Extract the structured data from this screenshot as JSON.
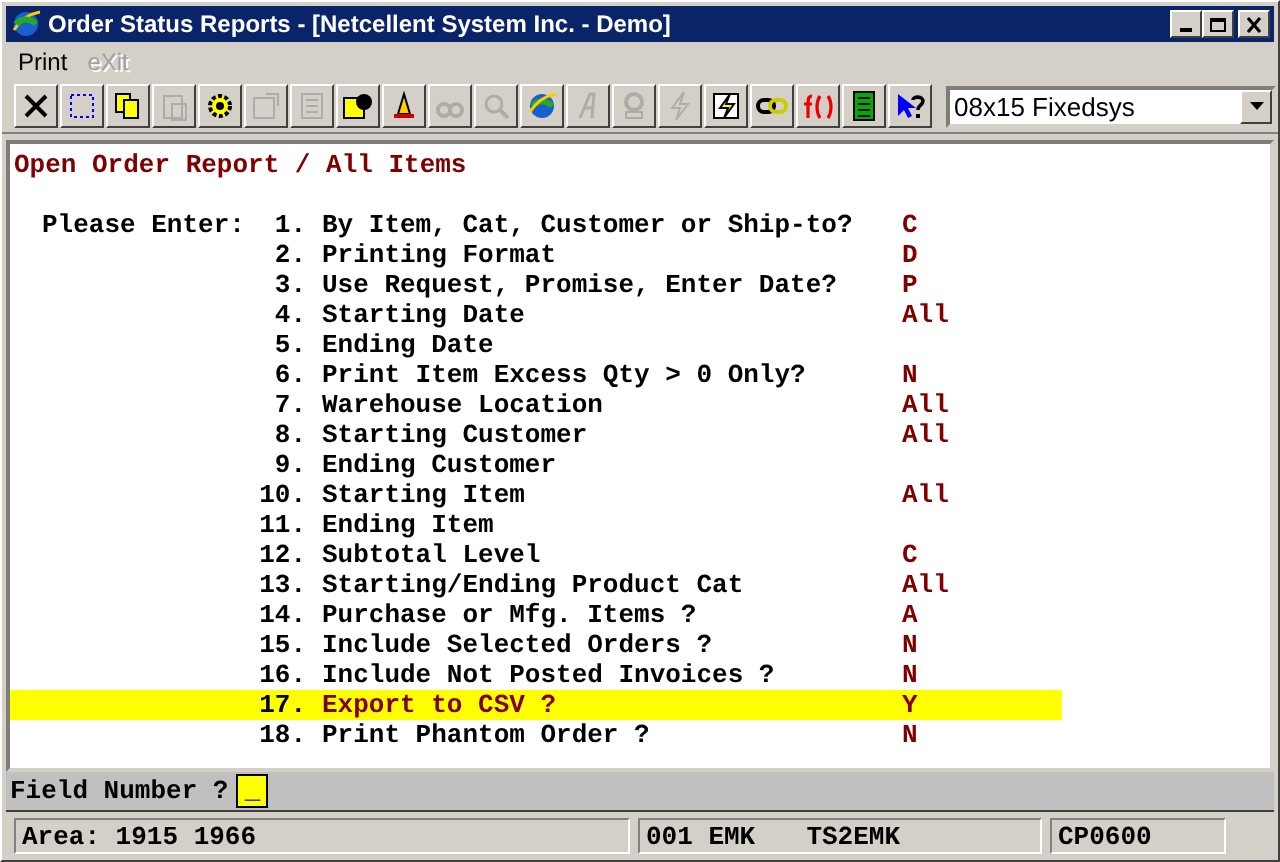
{
  "window": {
    "title": "Order Status Reports - [Netcellent System Inc. - Demo]"
  },
  "menu": [
    {
      "label": "Print",
      "disabled": false
    },
    {
      "label": "eXit",
      "disabled": true
    }
  ],
  "toolbar": [
    {
      "disabled": false
    },
    {
      "disabled": false
    },
    {
      "disabled": false
    },
    {
      "disabled": true
    },
    {
      "disabled": false
    },
    {
      "disabled": true
    },
    {
      "disabled": true
    },
    {
      "disabled": false
    },
    {
      "disabled": false
    },
    {
      "disabled": true
    },
    {
      "disabled": true
    },
    {
      "disabled": false
    },
    {
      "disabled": true
    },
    {
      "disabled": true
    },
    {
      "disabled": true
    },
    {
      "disabled": false
    },
    {
      "disabled": false
    },
    {
      "disabled": false
    },
    {
      "disabled": false
    },
    {
      "disabled": false
    }
  ],
  "font_select": {
    "value": "08x15 Fixedsys"
  },
  "report": {
    "title": "Open Order Report / All Items",
    "prompt": "Please Enter:",
    "fields": [
      {
        "number": "1.",
        "label": "By Item, Cat, Customer or Ship-to?",
        "value": "C",
        "selected": false
      },
      {
        "number": "2.",
        "label": "Printing Format",
        "value": "D",
        "selected": false
      },
      {
        "number": "3.",
        "label": "Use Request, Promise, Enter Date?",
        "value": "P",
        "selected": false
      },
      {
        "number": "4.",
        "label": "Starting Date",
        "value": "All",
        "selected": false
      },
      {
        "number": "5.",
        "label": "Ending Date",
        "selected": false
      },
      {
        "number": "6.",
        "label": "Print Item Excess Qty > 0 Only?",
        "value": "N",
        "selected": false
      },
      {
        "number": "7.",
        "label": "Warehouse Location",
        "value": "All",
        "selected": false
      },
      {
        "number": "8.",
        "label": "Starting Customer",
        "value": "All",
        "selected": false
      },
      {
        "number": "9.",
        "label": "Ending Customer",
        "selected": false
      },
      {
        "number": "10.",
        "label": "Starting Item",
        "value": "All",
        "selected": false
      },
      {
        "number": "11.",
        "label": "Ending Item",
        "selected": false
      },
      {
        "number": "12.",
        "label": "Subtotal Level",
        "value": "C",
        "selected": false
      },
      {
        "number": "13.",
        "label": "Starting/Ending Product Cat",
        "value": "All",
        "selected": false
      },
      {
        "number": "14.",
        "label": "Purchase or Mfg. Items ?",
        "value": "A",
        "selected": false
      },
      {
        "number": "15.",
        "label": "Include Selected Orders ?",
        "value": "N",
        "selected": false
      },
      {
        "number": "16.",
        "label": "Include Not Posted Invoices ?",
        "value": "N",
        "selected": false
      },
      {
        "number": "17.",
        "label": "Export to CSV ?",
        "value": "Y",
        "selected": true
      },
      {
        "number": "18.",
        "label": "Print Phantom Order ?",
        "value": "N",
        "selected": false
      }
    ]
  },
  "input_line": {
    "label": "Field Number ?",
    "value": "_"
  },
  "status_bar": [
    "Area: 1915 1966",
    "001 EMK",
    "TS2EMK",
    "CP0600"
  ]
}
